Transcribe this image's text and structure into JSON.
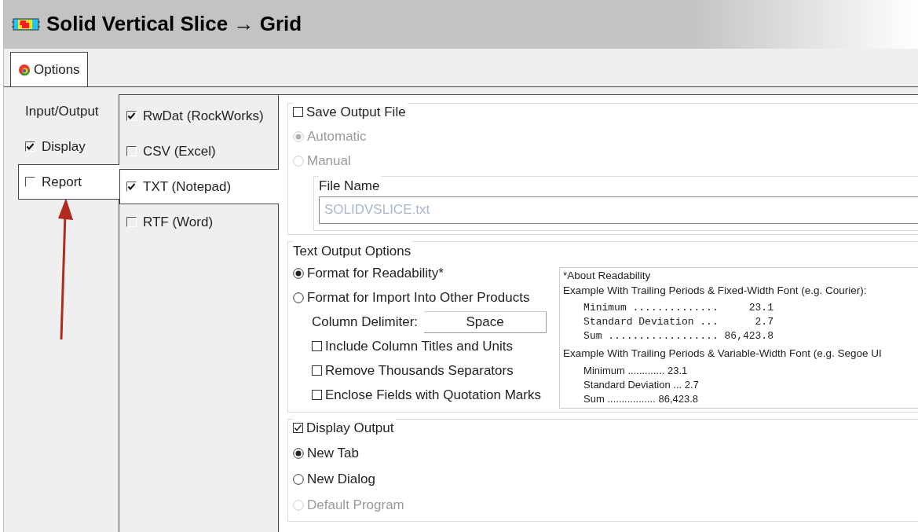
{
  "window": {
    "title": "Solid Vertical Slice → Grid"
  },
  "tabs": [
    {
      "label": "Options",
      "selected": true
    }
  ],
  "section_tabs": [
    {
      "label": "Input/Output",
      "kind": "plain",
      "selected": false
    },
    {
      "label": "Display",
      "kind": "check",
      "checked": true,
      "selected": false
    },
    {
      "label": "Report",
      "kind": "check",
      "checked": false,
      "selected": true
    }
  ],
  "format_tabs": [
    {
      "label": "RwDat (RockWorks)",
      "checked": true,
      "selected": false
    },
    {
      "label": "CSV (Excel)",
      "checked": false,
      "selected": false
    },
    {
      "label": "TXT (Notepad)",
      "checked": true,
      "selected": true
    },
    {
      "label": "RTF (Word)",
      "checked": false,
      "selected": false
    }
  ],
  "save_output": {
    "label": "Save Output File",
    "checked": false,
    "options": [
      {
        "label": "Automatic",
        "selected": true,
        "disabled": true
      },
      {
        "label": "Manual",
        "selected": false,
        "disabled": true
      }
    ],
    "file_name": {
      "label": "File Name",
      "value": "SOLIDVSLICE.txt",
      "disabled": true
    }
  },
  "text_output": {
    "label": "Text Output Options",
    "options": [
      {
        "label": "Format for Readability*",
        "selected": true,
        "disabled": false
      },
      {
        "label": "Format for Import Into Other Products",
        "selected": false,
        "disabled": false
      }
    ],
    "delimiter": {
      "label": "Column Delimiter:",
      "value": "Space"
    },
    "checkboxes": [
      {
        "label": "Include Column Titles and Units",
        "checked": false
      },
      {
        "label": "Remove Thousands Separators",
        "checked": false
      },
      {
        "label": "Enclose Fields with Quotation Marks",
        "checked": false
      }
    ],
    "about": {
      "title": "*About Readability",
      "fixed_caption": "Example With Trailing Periods & Fixed-Width Font (e.g. Courier):",
      "fixed_lines": [
        "Minimum ..............     23.1",
        "Standard Deviation ...      2.7",
        "Sum .................. 86,423.8"
      ],
      "variable_caption": "Example With Trailing Periods & Variable-Width Font (e.g. Segoe UI",
      "variable_lines": [
        "Minimum ............. 23.1",
        "Standard Deviation ... 2.7",
        "Sum ................. 86,423.8"
      ]
    }
  },
  "display_output": {
    "label": "Display Output",
    "checked": true,
    "options": [
      {
        "label": "New Tab",
        "selected": true,
        "disabled": false
      },
      {
        "label": "New Dialog",
        "selected": false,
        "disabled": false
      },
      {
        "label": "Default Program",
        "selected": false,
        "disabled": true
      }
    ]
  }
}
